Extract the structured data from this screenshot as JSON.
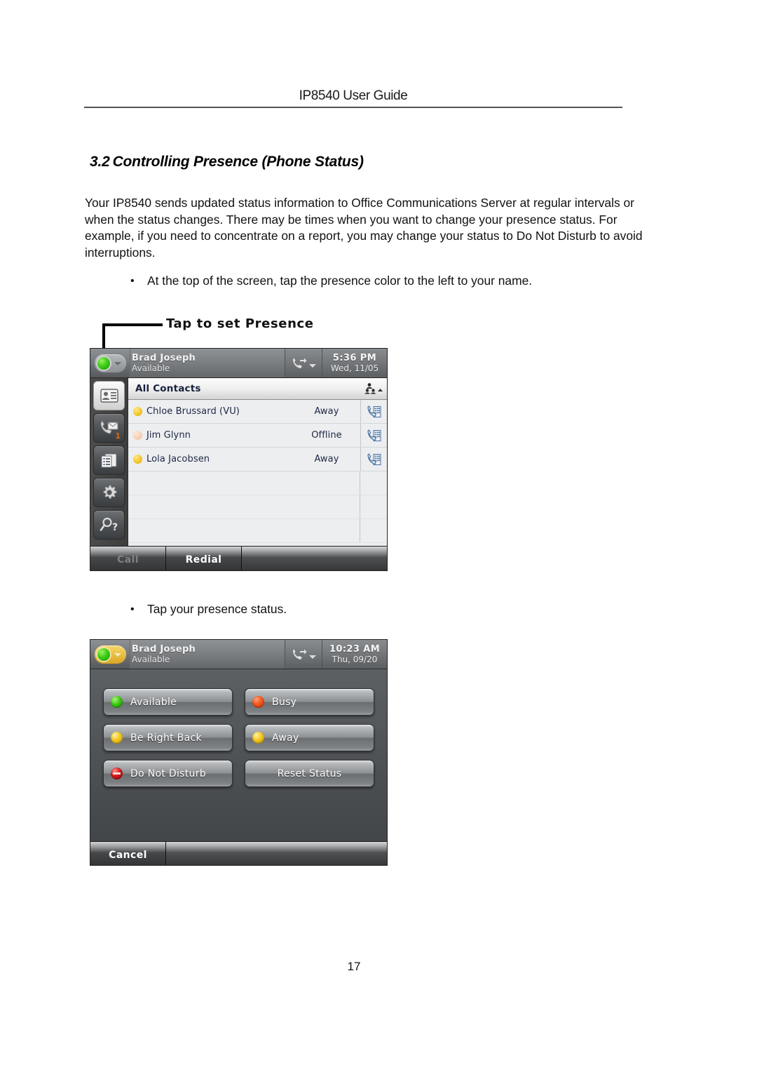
{
  "document": {
    "running_header": "IP8540 User Guide",
    "page_number": "17"
  },
  "section": {
    "number": "3.2",
    "title": "Controlling Presence (Phone Status)"
  },
  "body": {
    "paragraph": "Your IP8540 sends updated status information to Office Communications Server at regular intervals or when the status changes.  There may be times when you want to change your presence status.  For example, if you need to concentrate on a report, you may change your status to Do Not Disturb to avoid interruptions.",
    "bullet_marker": "•",
    "bullet_1": "At the top of the screen, tap the presence color to the left to your name.",
    "bullet_2": "Tap your presence status."
  },
  "callout": {
    "label": "Tap to set Presence"
  },
  "phone_contacts": {
    "status_bar": {
      "user_name": "Brad Joseph",
      "user_status": "Available",
      "presence_color": "#3fcc14",
      "time": "5:36 PM",
      "date": "Wed, 11/05",
      "forward_icon": "call-forward-icon",
      "presence_caret_icon": "chevron-down-icon"
    },
    "rail": [
      {
        "name": "contacts-icon",
        "badge": "",
        "active": true
      },
      {
        "name": "voicemail-icon",
        "badge": "1",
        "active": false
      },
      {
        "name": "call-log-icon",
        "badge": "",
        "active": false
      },
      {
        "name": "settings-gear-icon",
        "badge": "",
        "active": false
      },
      {
        "name": "search-help-icon",
        "badge": "",
        "active": false
      }
    ],
    "list": {
      "title": "All Contacts",
      "group_icon": "contact-group-icon",
      "rows": [
        {
          "name": "Chloe Brussard (VU)",
          "status": "Away",
          "presence": "away",
          "call_icon": "call-contact-icon"
        },
        {
          "name": "Jim Glynn",
          "status": "Offline",
          "presence": "offline",
          "call_icon": "call-contact-icon"
        },
        {
          "name": "Lola Jacobsen",
          "status": "Away",
          "presence": "away",
          "call_icon": "call-contact-icon"
        }
      ]
    },
    "softkeys": [
      {
        "label": "Call",
        "state": "disabled"
      },
      {
        "label": "Redial",
        "state": "enabled"
      }
    ]
  },
  "phone_presence_menu": {
    "status_bar": {
      "user_name": "Brad Joseph",
      "user_status": "Available",
      "presence_color": "#3fcc14",
      "highlight_color": "#e8bd3a",
      "time": "10:23 AM",
      "date": "Thu, 09/20",
      "forward_icon": "call-forward-icon",
      "presence_caret_icon": "chevron-down-icon"
    },
    "options": [
      {
        "label": "Available",
        "dot": "green"
      },
      {
        "label": "Busy",
        "dot": "red"
      },
      {
        "label": "Be Right Back",
        "dot": "yellow"
      },
      {
        "label": "Away",
        "dot": "yellow"
      },
      {
        "label": "Do Not Disturb",
        "dot": "dnd"
      },
      {
        "label": "Reset Status",
        "dot": "none"
      }
    ],
    "softkeys": [
      {
        "label": "Cancel",
        "state": "enabled"
      }
    ]
  }
}
